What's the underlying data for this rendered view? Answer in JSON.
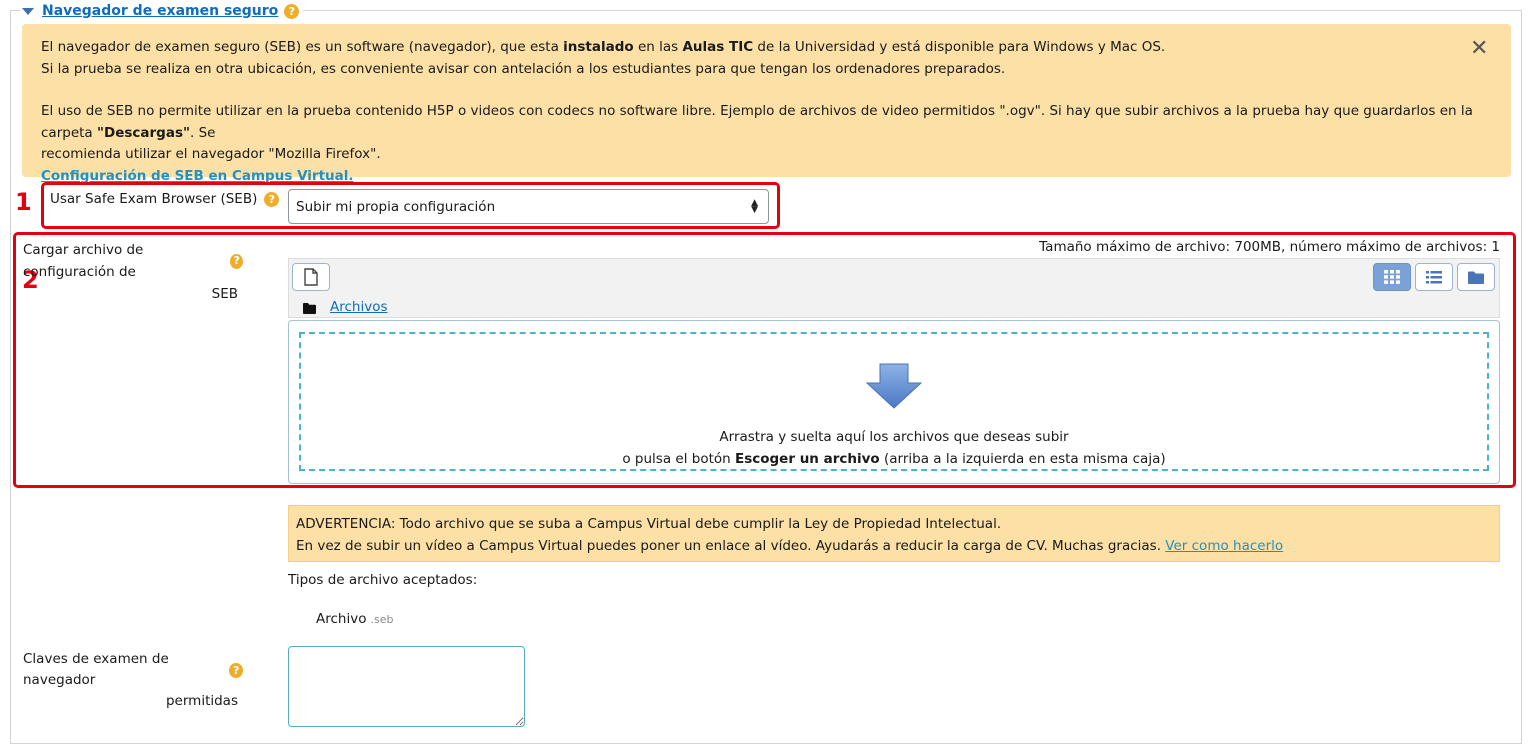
{
  "section": {
    "title": "Navegador de examen seguro",
    "help_glyph": "?"
  },
  "info": {
    "p1_a": "El navegador de examen seguro (SEB) es un software (navegador), que esta ",
    "p1_b": "instalado",
    "p1_c": " en las ",
    "p1_d": "Aulas TIC",
    "p1_e": " de la Universidad y está disponible para Windows y Mac OS.",
    "p2": "Si la prueba se realiza en otra ubicación, es conveniente avisar con antelación a los estudiantes para que tengan los ordenadores preparados.",
    "p3_a": "El uso de SEB no permite utilizar en la prueba contenido H5P o videos con codecs no software libre. Ejemplo de archivos de video permitidos \".ogv\". Si hay que subir archivos a la prueba hay que guardarlos en la carpeta ",
    "p3_b": "\"Descargas\"",
    "p3_c": ". Se",
    "p4": "recomienda utilizar el navegador \"Mozilla Firefox\".",
    "link": "Configuración de SEB en Campus Virtual.",
    "close_glyph": "✕"
  },
  "markers": {
    "one": "1",
    "two": "2"
  },
  "seb": {
    "label": "Usar Safe Exam Browser (SEB)",
    "selected": "Subir mi propia configuración"
  },
  "upload": {
    "label_line1": "Cargar archivo de configuración de",
    "label_line2": "SEB",
    "max_info": "Tamaño máximo de archivo: 700MB, número máximo de archivos: 1",
    "folder_link": "Archivos",
    "drop_line1": "Arrastra y suelta aquí los archivos que deseas subir",
    "drop_line2_a": "o pulsa el botón ",
    "drop_line2_b": "Escoger un archivo",
    "drop_line2_c": " (arriba a la izquierda en esta misma caja)"
  },
  "warning": {
    "line1": "ADVERTENCIA: Todo archivo que se suba a Campus Virtual debe cumplir la Ley de Propiedad Intelectual.",
    "line2": "En vez de subir un vídeo a Campus Virtual puedes poner un enlace al vídeo. Ayudarás a reducir la carga de CV. Muchas gracias. ",
    "link": "Ver como hacerlo"
  },
  "accepted": {
    "label": "Tipos de archivo aceptados:",
    "type_name": "Archivo",
    "type_ext": ".seb"
  },
  "keys": {
    "label_line1": "Claves de examen de navegador",
    "label_line2": "permitidas",
    "value": ""
  },
  "colors": {
    "alert_bg": "#fce0a6",
    "highlight": "#e4000f",
    "link": "#0f6cbf",
    "help": "#f0ad2b"
  }
}
